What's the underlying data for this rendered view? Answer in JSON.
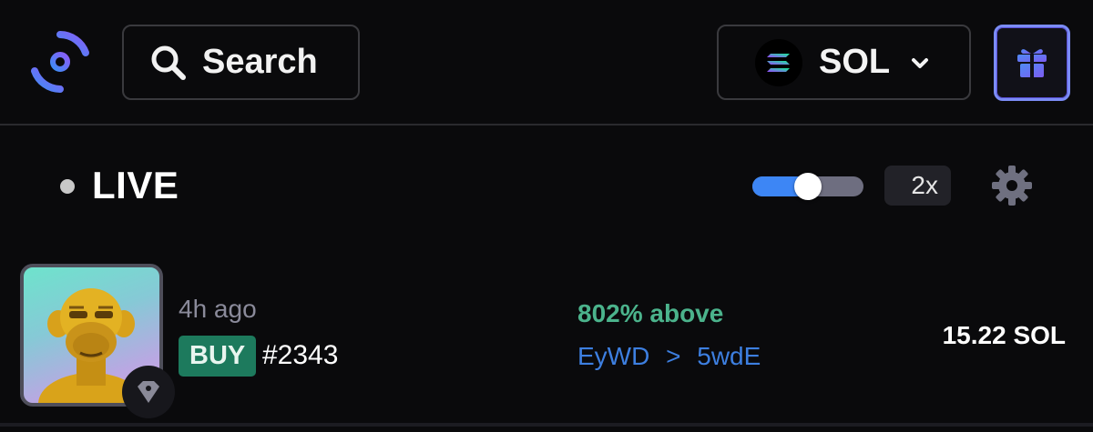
{
  "header": {
    "logo_icon": "crosshair-logo-icon",
    "search": {
      "label": "Search",
      "icon": "search-icon"
    },
    "chain_selector": {
      "label": "SOL",
      "icon": "solana-icon",
      "chevron": "chevron-down-icon"
    },
    "gift_button": {
      "icon": "gift-icon",
      "accent": "#7b8cf5"
    }
  },
  "feed": {
    "status_label": "LIVE",
    "speed": {
      "value": 0.5,
      "label": "2x"
    },
    "settings_icon": "gear-icon"
  },
  "activity": [
    {
      "time_ago": "4h ago",
      "type": "BUY",
      "token_id": "#2343",
      "price_diff": "802% above",
      "from_wallet": "EyWD",
      "arrow": ">",
      "to_wallet": "5wdE",
      "price": "15.22 SOL",
      "marketplace_icon": "tag-icon",
      "colors": {
        "buy": "#1d7a5d",
        "diff": "#4bb38c",
        "wallet": "#3d7fe0"
      }
    }
  ]
}
